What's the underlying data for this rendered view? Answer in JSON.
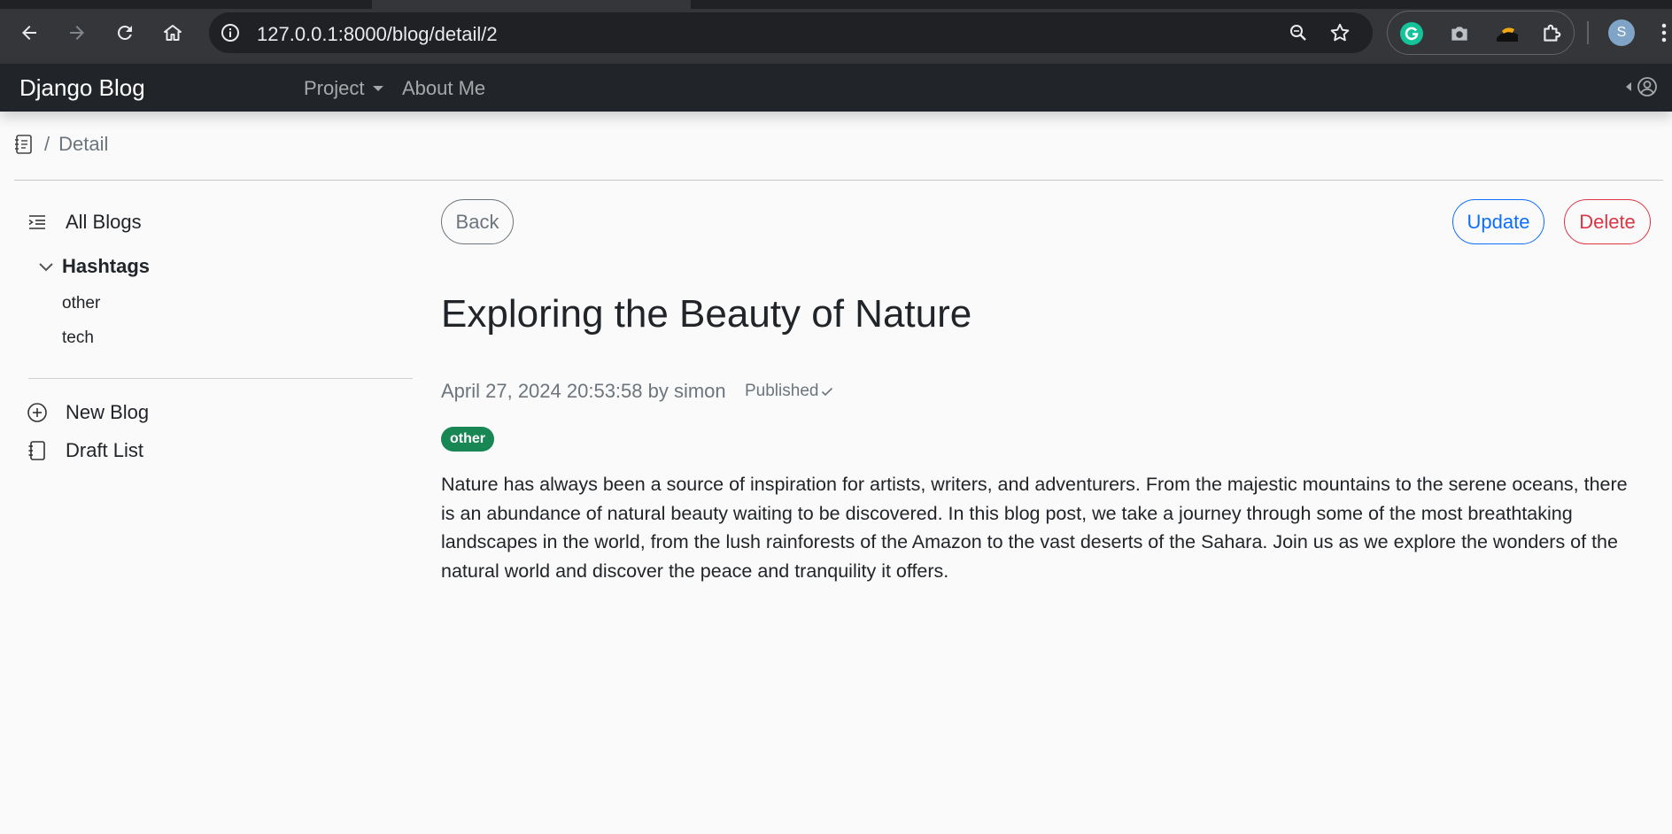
{
  "browser": {
    "url_host": "127.0.0.1",
    "url_path": ":8000/blog/detail/2",
    "profile_initial": "S",
    "icons": [
      "back-arrow-icon",
      "forward-arrow-icon",
      "reload-icon",
      "home-icon",
      "info-icon",
      "zoom-icon",
      "star-icon",
      "grammarly-icon",
      "camera-icon",
      "extension-image-icon",
      "puzzle-icon",
      "menu-icon"
    ]
  },
  "navbar": {
    "brand": "Django Blog",
    "links": [
      {
        "label": "Project"
      },
      {
        "label": "About Me"
      }
    ]
  },
  "breadcrumb": {
    "separator": "/",
    "current": "Detail"
  },
  "sidebar": {
    "all_blogs": "All Blogs",
    "hashtags_label": "Hashtags",
    "hashtags": [
      "other",
      "tech"
    ],
    "new_blog": "New Blog",
    "draft_list": "Draft List"
  },
  "post": {
    "back_label": "Back",
    "update_label": "Update",
    "delete_label": "Delete",
    "title": "Exploring the Beauty of Nature",
    "meta": "April 27, 2024 20:53:58 by simon",
    "status": "Published",
    "tag": "other",
    "body": "Nature has always been a source of inspiration for artists, writers, and adventurers. From the majestic mountains to the serene oceans, there is an abundance of natural beauty waiting to be discovered. In this blog post, we take a journey through some of the most breathtaking landscapes in the world, from the lush rainforests of the Amazon to the vast deserts of the Sahara. Join us as we explore the wonders of the natural world and discover the peace and tranquility it offers."
  },
  "colors": {
    "navbar_bg": "#212529",
    "primary": "#0d6efd",
    "danger": "#dc3545",
    "secondary": "#6c757d",
    "badge_success": "#198754",
    "page_bg": "#fafafa"
  }
}
